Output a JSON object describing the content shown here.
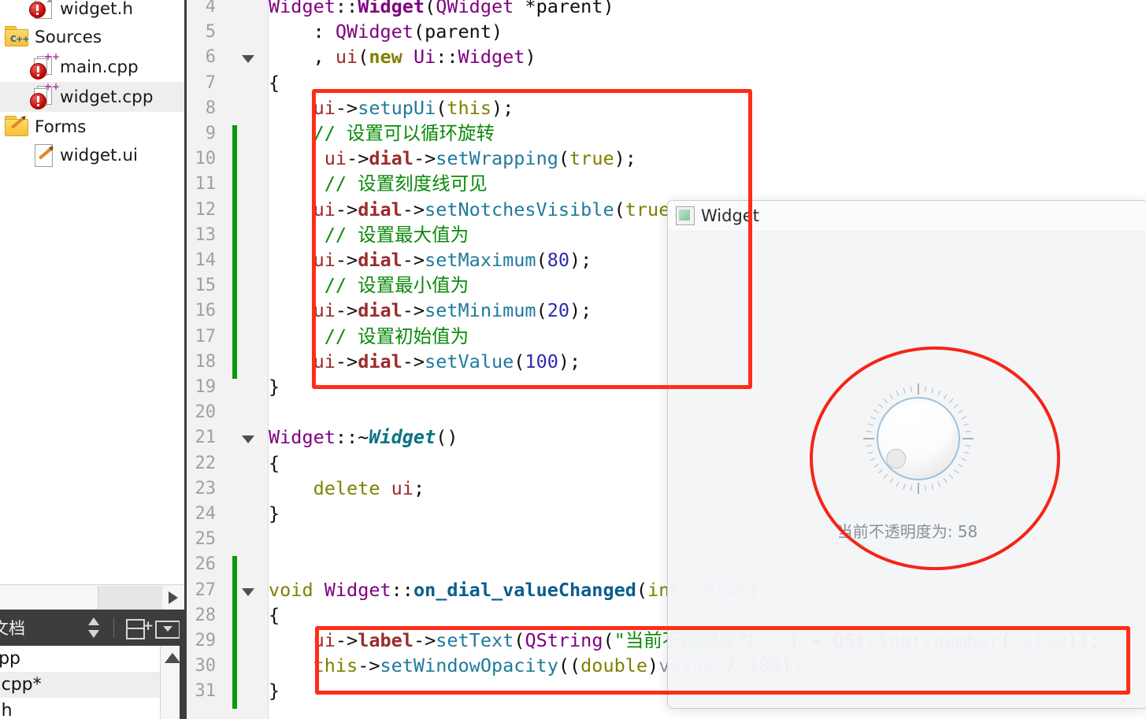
{
  "project_tree": {
    "items": [
      {
        "label": "widget.h",
        "icon": "header-file-error-icon",
        "indent": 36,
        "selected": false
      },
      {
        "label": "Sources",
        "icon": "folder-sources-icon",
        "indent": 4,
        "selected": false
      },
      {
        "label": "main.cpp",
        "icon": "cpp-source-icon",
        "indent": 36,
        "selected": false
      },
      {
        "label": "widget.cpp",
        "icon": "cpp-source-icon",
        "indent": 36,
        "selected": true
      },
      {
        "label": "Forms",
        "icon": "folder-forms-icon",
        "indent": 4,
        "selected": false
      },
      {
        "label": "widget.ui",
        "icon": "ui-form-icon",
        "indent": 36,
        "selected": false
      }
    ]
  },
  "docs_panel": {
    "title": "文档",
    "sort_icon": "sort-updown-icon",
    "split_icon": "split-add-icon",
    "menu_icon": "dropdown-icon",
    "documents": [
      {
        "label": "cpp",
        "selected": false
      },
      {
        "label": "t.cpp*",
        "selected": true
      },
      {
        "label": "t.h",
        "selected": false
      }
    ]
  },
  "editor": {
    "first_line": 4,
    "lines": [
      {
        "n": 4,
        "fold": false,
        "changed": false,
        "tokens": [
          {
            "t": "Widget",
            "c": "t-cls"
          },
          {
            "t": "::",
            "c": "t-op"
          },
          {
            "t": "Widget",
            "c": "t-clsb"
          },
          {
            "t": "(",
            "c": "t-op"
          },
          {
            "t": "QWidget",
            "c": "t-cls"
          },
          {
            "t": " *parent)",
            "c": "t-plain"
          }
        ]
      },
      {
        "n": 5,
        "fold": false,
        "changed": false,
        "tokens": [
          {
            "t": "    : ",
            "c": "t-plain"
          },
          {
            "t": "QWidget",
            "c": "t-cls"
          },
          {
            "t": "(parent)",
            "c": "t-plain"
          }
        ]
      },
      {
        "n": 6,
        "fold": true,
        "changed": false,
        "tokens": [
          {
            "t": "    , ",
            "c": "t-plain"
          },
          {
            "t": "ui",
            "c": "t-mem"
          },
          {
            "t": "(",
            "c": "t-op"
          },
          {
            "t": "new",
            "c": "t-kwb"
          },
          {
            "t": " ",
            "c": "t-plain"
          },
          {
            "t": "Ui",
            "c": "t-cls"
          },
          {
            "t": "::",
            "c": "t-op"
          },
          {
            "t": "Widget",
            "c": "t-cls"
          },
          {
            "t": ")",
            "c": "t-op"
          }
        ]
      },
      {
        "n": 7,
        "fold": false,
        "changed": false,
        "tokens": [
          {
            "t": "{",
            "c": "t-plain"
          }
        ]
      },
      {
        "n": 8,
        "fold": false,
        "changed": false,
        "tokens": [
          {
            "t": "    ",
            "c": "t-plain"
          },
          {
            "t": "ui",
            "c": "t-mem"
          },
          {
            "t": "->",
            "c": "t-op"
          },
          {
            "t": "setupUi",
            "c": "t-call"
          },
          {
            "t": "(",
            "c": "t-op"
          },
          {
            "t": "this",
            "c": "t-kw"
          },
          {
            "t": ");",
            "c": "t-op"
          }
        ]
      },
      {
        "n": 9,
        "fold": false,
        "changed": true,
        "tokens": [
          {
            "t": "    // 设置可以循环旋转",
            "c": "t-cmt"
          }
        ]
      },
      {
        "n": 10,
        "fold": false,
        "changed": true,
        "tokens": [
          {
            "t": "     ",
            "c": "t-plain"
          },
          {
            "t": "ui",
            "c": "t-mem"
          },
          {
            "t": "->",
            "c": "t-op"
          },
          {
            "t": "dial",
            "c": "t-memb"
          },
          {
            "t": "->",
            "c": "t-op"
          },
          {
            "t": "setWrapping",
            "c": "t-call"
          },
          {
            "t": "(",
            "c": "t-op"
          },
          {
            "t": "true",
            "c": "t-kw"
          },
          {
            "t": ");",
            "c": "t-op"
          }
        ]
      },
      {
        "n": 11,
        "fold": false,
        "changed": true,
        "tokens": [
          {
            "t": "     // 设置刻度线可见",
            "c": "t-cmt"
          }
        ]
      },
      {
        "n": 12,
        "fold": false,
        "changed": true,
        "tokens": [
          {
            "t": "    ",
            "c": "t-plain"
          },
          {
            "t": "ui",
            "c": "t-mem"
          },
          {
            "t": "->",
            "c": "t-op"
          },
          {
            "t": "dial",
            "c": "t-memb"
          },
          {
            "t": "->",
            "c": "t-op"
          },
          {
            "t": "setNotchesVisible",
            "c": "t-call"
          },
          {
            "t": "(",
            "c": "t-op"
          },
          {
            "t": "true",
            "c": "t-kw"
          },
          {
            "t": ");",
            "c": "t-op"
          }
        ]
      },
      {
        "n": 13,
        "fold": false,
        "changed": true,
        "tokens": [
          {
            "t": "     // 设置最大值为",
            "c": "t-cmt"
          }
        ]
      },
      {
        "n": 14,
        "fold": false,
        "changed": true,
        "tokens": [
          {
            "t": "    ",
            "c": "t-plain"
          },
          {
            "t": "ui",
            "c": "t-mem"
          },
          {
            "t": "->",
            "c": "t-op"
          },
          {
            "t": "dial",
            "c": "t-memb"
          },
          {
            "t": "->",
            "c": "t-op"
          },
          {
            "t": "setMaximum",
            "c": "t-call"
          },
          {
            "t": "(",
            "c": "t-op"
          },
          {
            "t": "80",
            "c": "t-num"
          },
          {
            "t": ");",
            "c": "t-op"
          }
        ]
      },
      {
        "n": 15,
        "fold": false,
        "changed": true,
        "tokens": [
          {
            "t": "     // 设置最小值为",
            "c": "t-cmt"
          }
        ]
      },
      {
        "n": 16,
        "fold": false,
        "changed": true,
        "tokens": [
          {
            "t": "    ",
            "c": "t-plain"
          },
          {
            "t": "ui",
            "c": "t-mem"
          },
          {
            "t": "->",
            "c": "t-op"
          },
          {
            "t": "dial",
            "c": "t-memb"
          },
          {
            "t": "->",
            "c": "t-op"
          },
          {
            "t": "setMinimum",
            "c": "t-call"
          },
          {
            "t": "(",
            "c": "t-op"
          },
          {
            "t": "20",
            "c": "t-num"
          },
          {
            "t": ");",
            "c": "t-op"
          }
        ]
      },
      {
        "n": 17,
        "fold": false,
        "changed": true,
        "tokens": [
          {
            "t": "     // 设置初始值为",
            "c": "t-cmt"
          }
        ]
      },
      {
        "n": 18,
        "fold": false,
        "changed": true,
        "tokens": [
          {
            "t": "    ",
            "c": "t-plain"
          },
          {
            "t": "ui",
            "c": "t-mem"
          },
          {
            "t": "->",
            "c": "t-op"
          },
          {
            "t": "dial",
            "c": "t-memb"
          },
          {
            "t": "->",
            "c": "t-op"
          },
          {
            "t": "setValue",
            "c": "t-call"
          },
          {
            "t": "(",
            "c": "t-op"
          },
          {
            "t": "100",
            "c": "t-num"
          },
          {
            "t": ");",
            "c": "t-op"
          }
        ]
      },
      {
        "n": 19,
        "fold": false,
        "changed": false,
        "tokens": [
          {
            "t": "}",
            "c": "t-plain"
          }
        ]
      },
      {
        "n": 20,
        "fold": false,
        "changed": false,
        "tokens": []
      },
      {
        "n": 21,
        "fold": true,
        "changed": false,
        "tokens": [
          {
            "t": "Widget",
            "c": "t-cls"
          },
          {
            "t": "::~",
            "c": "t-op"
          },
          {
            "t": "Widget",
            "c": "t-typbi"
          },
          {
            "t": "()",
            "c": "t-plain"
          }
        ]
      },
      {
        "n": 22,
        "fold": false,
        "changed": false,
        "tokens": [
          {
            "t": "{",
            "c": "t-plain"
          }
        ]
      },
      {
        "n": 23,
        "fold": false,
        "changed": false,
        "tokens": [
          {
            "t": "    ",
            "c": "t-plain"
          },
          {
            "t": "delete",
            "c": "t-kw"
          },
          {
            "t": " ",
            "c": "t-plain"
          },
          {
            "t": "ui",
            "c": "t-mem"
          },
          {
            "t": ";",
            "c": "t-op"
          }
        ]
      },
      {
        "n": 24,
        "fold": false,
        "changed": false,
        "tokens": [
          {
            "t": "}",
            "c": "t-plain"
          }
        ]
      },
      {
        "n": 25,
        "fold": false,
        "changed": false,
        "tokens": []
      },
      {
        "n": 26,
        "fold": false,
        "changed": true,
        "tokens": []
      },
      {
        "n": 27,
        "fold": true,
        "changed": true,
        "tokens": [
          {
            "t": "void",
            "c": "t-kw"
          },
          {
            "t": " ",
            "c": "t-plain"
          },
          {
            "t": "Widget",
            "c": "t-cls"
          },
          {
            "t": "::",
            "c": "t-op"
          },
          {
            "t": "on_dial_valueChanged",
            "c": "t-fn"
          },
          {
            "t": "(",
            "c": "t-op"
          },
          {
            "t": "int",
            "c": "t-kw"
          },
          {
            "t": " ",
            "c": "t-plain"
          },
          {
            "t": "value",
            "c": "t-var"
          },
          {
            "t": ")",
            "c": "t-op"
          }
        ]
      },
      {
        "n": 28,
        "fold": false,
        "changed": true,
        "tokens": [
          {
            "t": "{",
            "c": "t-plain"
          }
        ]
      },
      {
        "n": 29,
        "fold": false,
        "changed": true,
        "tokens": [
          {
            "t": "    ",
            "c": "t-plain"
          },
          {
            "t": "ui",
            "c": "t-mem"
          },
          {
            "t": "->",
            "c": "t-op"
          },
          {
            "t": "label",
            "c": "t-memb"
          },
          {
            "t": "->",
            "c": "t-op"
          },
          {
            "t": "setText",
            "c": "t-call"
          },
          {
            "t": "(",
            "c": "t-op"
          },
          {
            "t": "QString",
            "c": "t-cls"
          },
          {
            "t": "(",
            "c": "t-op"
          },
          {
            "t": "\"当前不透明度为: \"",
            "c": "t-str"
          },
          {
            "t": ")",
            "c": "t-op"
          },
          {
            "t": " + ",
            "c": "t-plain"
          },
          {
            "t": "QString",
            "c": "t-cls"
          },
          {
            "t": "::",
            "c": "t-op"
          },
          {
            "t": "number",
            "c": "t-call"
          },
          {
            "t": "(",
            "c": "t-op"
          },
          {
            "t": "value",
            "c": "t-var"
          },
          {
            "t": "));",
            "c": "t-op"
          }
        ]
      },
      {
        "n": 30,
        "fold": false,
        "changed": true,
        "tokens": [
          {
            "t": "    ",
            "c": "t-plain"
          },
          {
            "t": "this",
            "c": "t-kw"
          },
          {
            "t": "->",
            "c": "t-op"
          },
          {
            "t": "setWindowOpacity",
            "c": "t-call"
          },
          {
            "t": "((",
            "c": "t-op"
          },
          {
            "t": "double",
            "c": "t-kw"
          },
          {
            "t": ")",
            "c": "t-op"
          },
          {
            "t": "value",
            "c": "t-var"
          },
          {
            "t": " / ",
            "c": "t-plain"
          },
          {
            "t": "100",
            "c": "t-num"
          },
          {
            "t": ");",
            "c": "t-op"
          }
        ]
      },
      {
        "n": 31,
        "fold": false,
        "changed": true,
        "tokens": [
          {
            "t": "}",
            "c": "t-plain"
          }
        ]
      }
    ]
  },
  "qt_window": {
    "title": "Widget",
    "app_icon": "qt-app-icon",
    "dial": {
      "value": 58,
      "minimum": 20,
      "maximum": 80,
      "notches_visible": true,
      "wrapping": true,
      "notch_count": 44
    },
    "label_text": "当前不透明度为: 58"
  },
  "annotations": {
    "color": "#ff2d18",
    "shapes": [
      {
        "name": "redbox-top",
        "type": "rectangle"
      },
      {
        "name": "redbox-bottom",
        "type": "rectangle"
      },
      {
        "name": "red-ellipse",
        "type": "ellipse"
      }
    ]
  },
  "colors": {
    "accent_red": "#ff2d18",
    "change_marker_green": "#0a9a0a",
    "comment_green": "#0a8a0a",
    "gutter_bg": "#f2f2f2",
    "panel_dark": "#3d3d3d",
    "selection_gray": "#eeeeee"
  }
}
